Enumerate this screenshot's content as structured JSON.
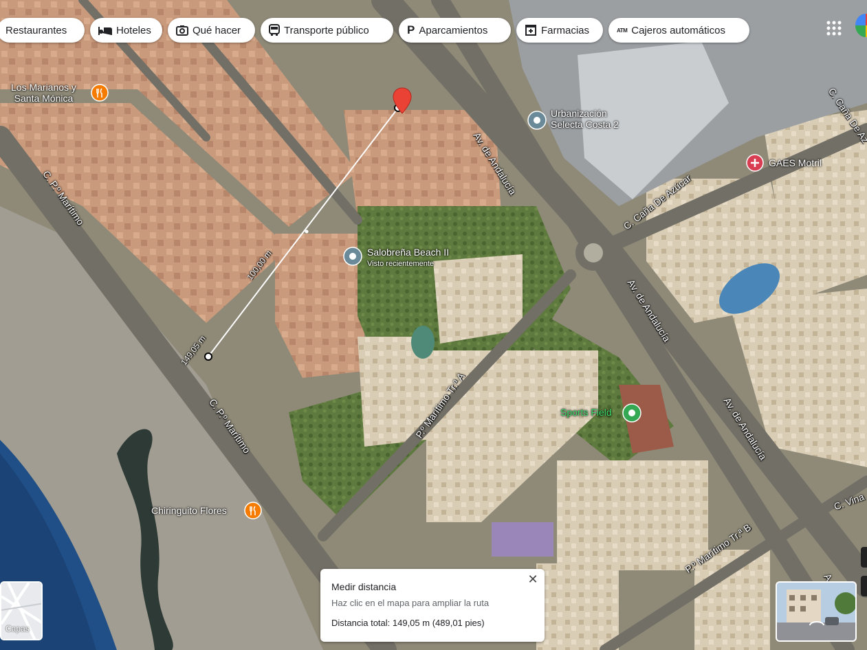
{
  "chips": [
    {
      "label": "Restaurantes",
      "icon": "restaurant-icon"
    },
    {
      "label": "Hoteles",
      "icon": "bed-icon"
    },
    {
      "label": "Qué hacer",
      "icon": "camera-icon"
    },
    {
      "label": "Transporte público",
      "icon": "bus-icon"
    },
    {
      "label": "Aparcamientos",
      "icon": "parking-icon"
    },
    {
      "label": "Farmacias",
      "icon": "pharmacy-icon"
    },
    {
      "label": "Cajeros automáticos",
      "icon": "atm-icon"
    }
  ],
  "apps_icon": "apps-grid-icon",
  "pois": {
    "los_marianos": "Los Marianos y\nSanta Mónica",
    "urbanizacion": "Urbanización\nSelecta Costa 2",
    "gaes": "GAES Motril",
    "salobrena": "Salobreña Beach II",
    "salobrena_sub": "Visto recientemente",
    "sports_field": "Sports Field",
    "chiringuito": "Chiringuito Flores"
  },
  "roads": {
    "paseo_maritimo_1": "C. P.º Marítimo",
    "paseo_maritimo_2": "C. P.º Marítimo",
    "av_andalucia_1": "Av. de Andalucía",
    "av_andalucia_2": "Av. de Andalucía",
    "av_andalucia_3": "Av. de Andalucía",
    "cana_azucar_1": "C. Caña De Azúcar",
    "cana_azucar_2": "C. Caña De Az",
    "maritimo_tra": "P.º Marítimo Tr.ª A",
    "maritimo_trb": "P.º Marítimo Tr.ª B",
    "vina": "C. Vina",
    "andalucia_edge": "A"
  },
  "measure": {
    "label_100": "100,00 m",
    "label_total": "149,05 m"
  },
  "distance_panel": {
    "title": "Medir distancia",
    "hint": "Haz clic en el mapa para ampliar la ruta",
    "total": "Distancia total: 149,05 m (489,01 pies)",
    "close": "✕"
  },
  "layers_label": "Capas",
  "colors": {
    "pin": "#ea4335",
    "restaurant": "#f57c00",
    "poi_gray": "#6b8a99",
    "sports": "#34a853",
    "gaes": "#d93d52"
  }
}
